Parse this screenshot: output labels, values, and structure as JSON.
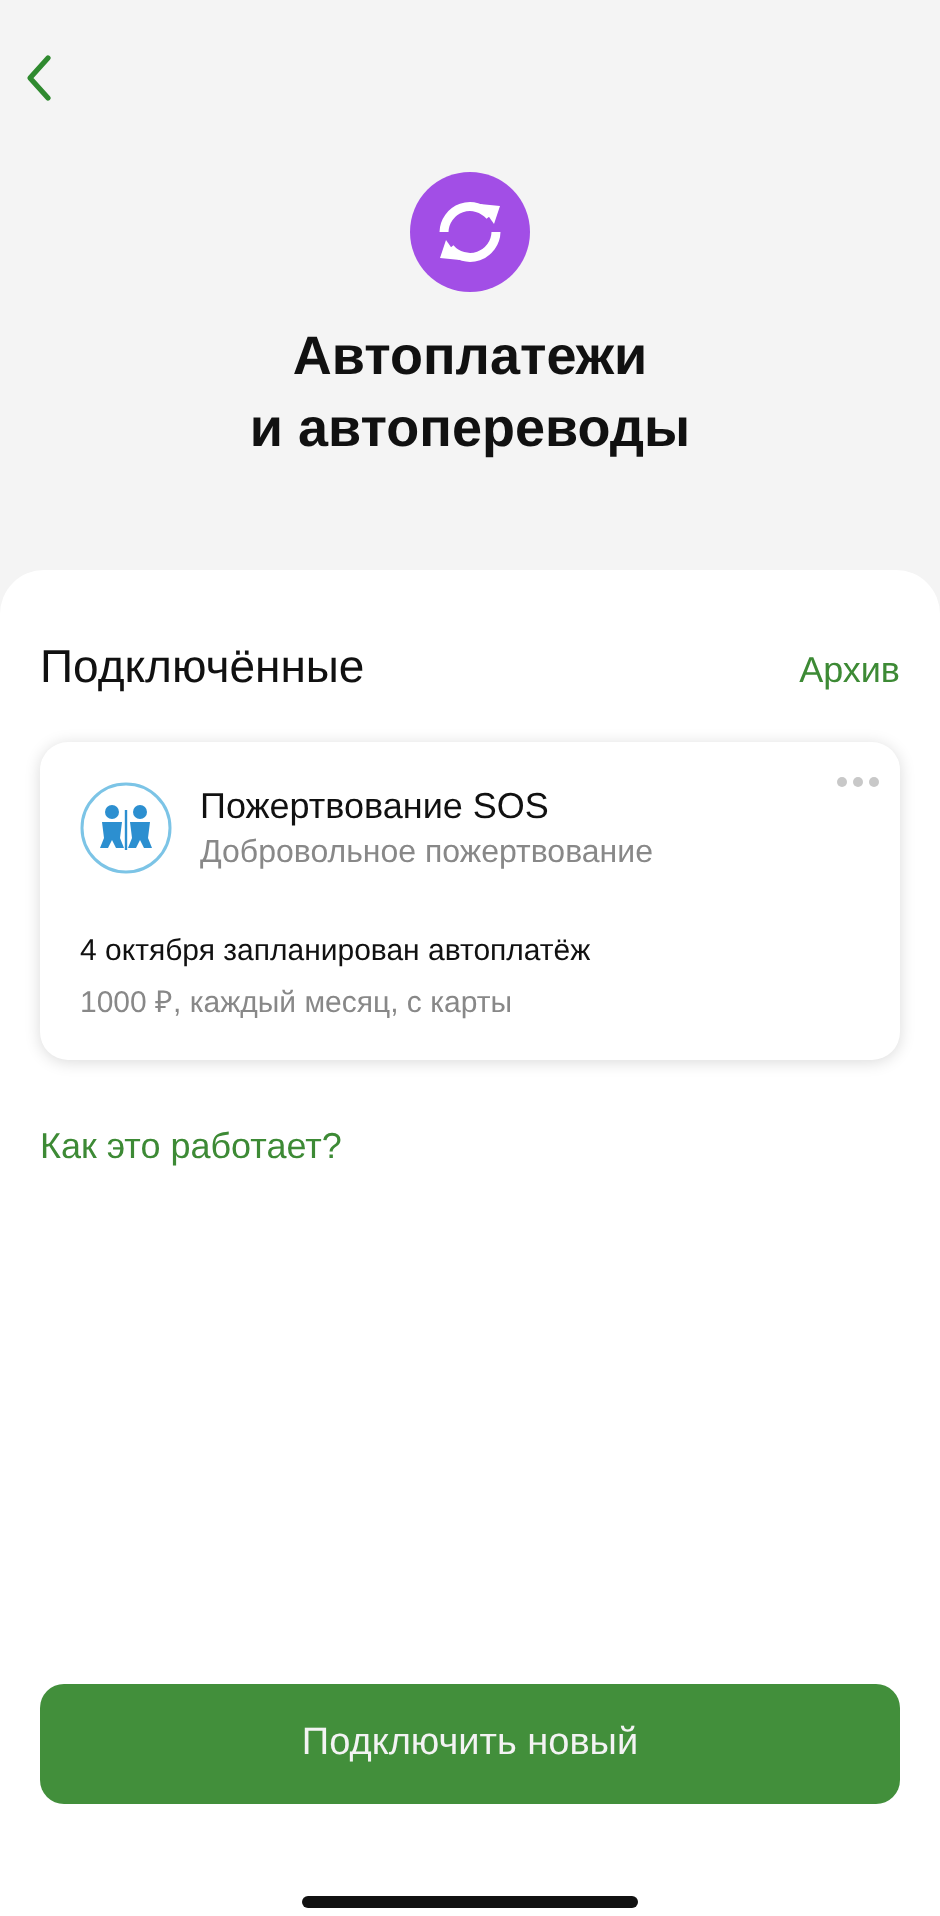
{
  "header": {
    "title_line_1": "Автоплатежи",
    "title_line_2": "и автопереводы"
  },
  "section": {
    "title": "Подключённые",
    "archive_link": "Архив"
  },
  "payments": [
    {
      "name": "Пожертвование SOS",
      "subtitle": "Добровольное пожертвование",
      "schedule": "4 октября запланирован автоплатёж",
      "details": "1000 ₽, каждый месяц, с карты"
    }
  ],
  "help_link": "Как это работает?",
  "primary_button": "Подключить новый"
}
